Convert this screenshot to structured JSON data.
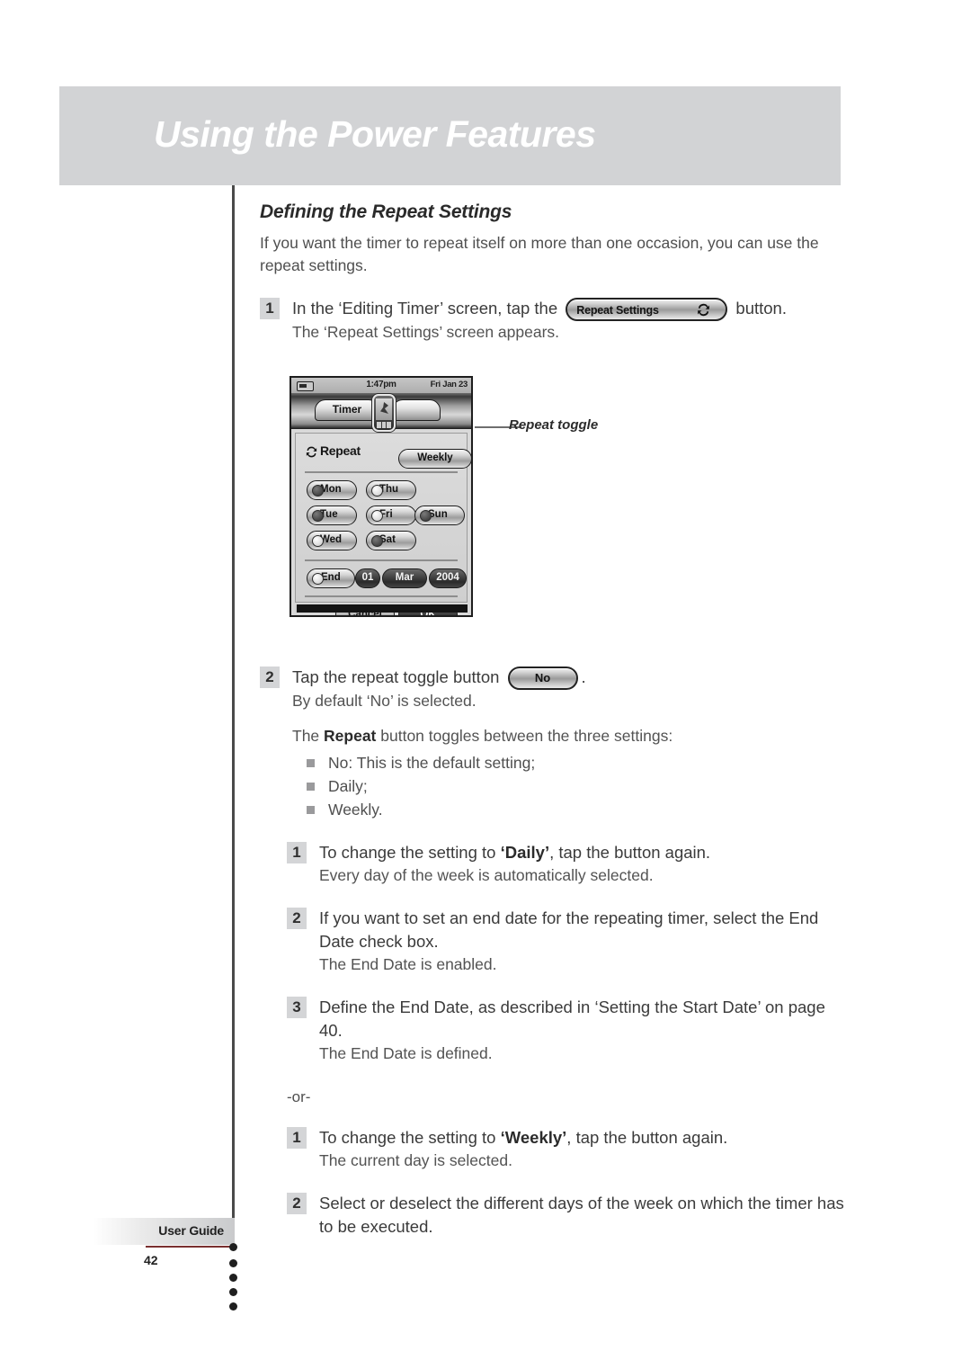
{
  "header": {
    "title": "Using the Power Features"
  },
  "section": {
    "title": "Defining the Repeat Settings",
    "intro": "If you want the timer to repeat itself on more than one occasion, you can use the repeat settings."
  },
  "steps": {
    "step1": {
      "num": "1",
      "text_before": "In the ‘Editing Timer’ screen, tap the",
      "button_label": "Repeat Settings",
      "button_icon": "repeat-arrows-icon",
      "text_after": "button.",
      "note": "The ‘Repeat Settings’ screen appears."
    },
    "step2": {
      "num": "2",
      "text_before": "Tap the repeat toggle button",
      "button_label": "No",
      "text_after": ".",
      "note": "By default ‘No’ is selected.",
      "toggle_intro_before": "The ",
      "toggle_intro_bold": "Repeat",
      "toggle_intro_after": " button toggles between the three settings:",
      "bullets": [
        "No: This is the default setting;",
        "Daily;",
        "Weekly."
      ]
    },
    "daily": {
      "sub1": {
        "num": "1",
        "text_before": "To change the setting to ",
        "text_bold": "‘Daily’",
        "text_after": ", tap the button again.",
        "note": "Every day of the week is automatically selected."
      },
      "sub2": {
        "num": "2",
        "text": "If you want to set an end date for the repeating timer, select the End Date check box.",
        "note": "The End Date is enabled."
      },
      "sub3": {
        "num": "3",
        "text": "Define the End Date, as described in ‘Setting the Start Date’ on page 40.",
        "note": "The End Date is defined."
      }
    },
    "or_separator": "-or-",
    "weekly": {
      "sub1": {
        "num": "1",
        "text_before": "To change the setting to ",
        "text_bold": "‘Weekly’",
        "text_after": ", tap the button again.",
        "note": "The current day is selected."
      },
      "sub2": {
        "num": "2",
        "text": "Select or deselect the different days of the week on which the timer has to be executed.",
        "note": ""
      }
    }
  },
  "callout": {
    "label": "Repeat toggle"
  },
  "device": {
    "status": {
      "battery_icon": "battery-icon",
      "time": "1:47pm",
      "date": "Fri Jan 23"
    },
    "tabs": {
      "active": "Timer",
      "inactive": "",
      "thumb_icon": "device-thumbnail-icon"
    },
    "repeat": {
      "icon": "repeat-arrows-icon",
      "label": "Repeat",
      "value": "Weekly"
    },
    "days": [
      {
        "label": "Mon",
        "selected": true
      },
      {
        "label": "Thu",
        "selected": false
      },
      {
        "label": "Tue",
        "selected": true
      },
      {
        "label": "Fri",
        "selected": false
      },
      {
        "label": "Sun",
        "selected": true
      },
      {
        "label": "Wed",
        "selected": false
      },
      {
        "label": "Sat",
        "selected": true
      }
    ],
    "end_date": {
      "label": "End",
      "selected": false,
      "day": "01",
      "month": "Mar",
      "year": "2004"
    },
    "actions": {
      "cancel": "Cancel",
      "ok": "OK"
    }
  },
  "footer": {
    "label": "User Guide",
    "page": "42"
  },
  "colors": {
    "header_band": "#d2d3d5",
    "badge": "#d4d5d7",
    "bullet": "#9a9a9c",
    "rule": "#4a4a4a",
    "footer_underline": "#7a3030"
  }
}
